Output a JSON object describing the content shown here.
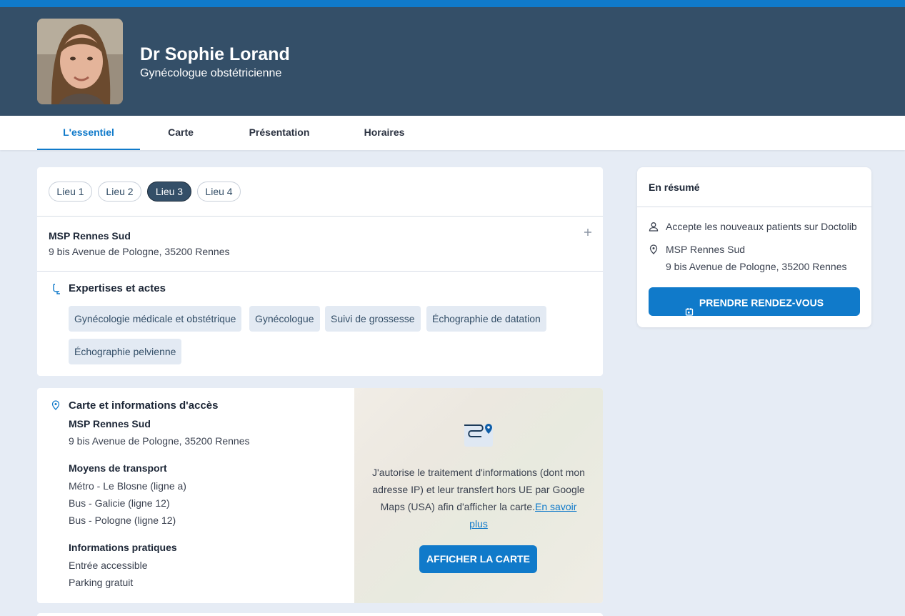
{
  "header": {
    "name": "Dr Sophie Lorand",
    "specialty": "Gynécologue obstétricienne"
  },
  "tabs": [
    {
      "label": "L'essentiel"
    },
    {
      "label": "Carte"
    },
    {
      "label": "Présentation"
    },
    {
      "label": "Horaires"
    }
  ],
  "lieux": [
    {
      "label": "Lieu 1"
    },
    {
      "label": "Lieu 2"
    },
    {
      "label": "Lieu 3"
    },
    {
      "label": "Lieu 4"
    }
  ],
  "location": {
    "name": "MSP Rennes Sud",
    "address": "9 bis Avenue de Pologne, 35200 Rennes"
  },
  "expertises": {
    "title": "Expertises et actes",
    "chips": [
      "Gynécologie médicale et obstétrique",
      "Gynécologue",
      "Suivi de grossesse",
      "Échographie de datation",
      "Échographie pelvienne"
    ]
  },
  "access": {
    "title": "Carte et informations d'accès",
    "name": "MSP Rennes Sud",
    "address": "9 bis Avenue de Pologne, 35200 Rennes",
    "transport_title": "Moyens de transport",
    "transport": [
      "Métro - Le Blosne (ligne a)",
      "Bus - Galicie (ligne 12)",
      "Bus - Pologne (ligne 12)"
    ],
    "info_title": "Informations pratiques",
    "info": [
      "Entrée accessible",
      "Parking gratuit"
    ]
  },
  "map": {
    "consent_text": "J'autorise le traitement d'informations (dont mon adresse IP) et leur transfert hors UE par Google Maps (USA) afin d'afficher la carte.",
    "link_text": "En savoir plus",
    "button": "AFFICHER LA CARTE"
  },
  "summary": {
    "title": "En résumé",
    "accepts": "Accepte les nouveaux patients sur Doctolib",
    "location_name": "MSP Rennes Sud",
    "location_address": "9 bis Avenue de Pologne, 35200 Rennes",
    "button": "PRENDRE RENDEZ-VOUS"
  },
  "colors": {
    "accent": "#107aca",
    "header_bg": "#344f68",
    "page_bg": "#e6ecf5"
  }
}
